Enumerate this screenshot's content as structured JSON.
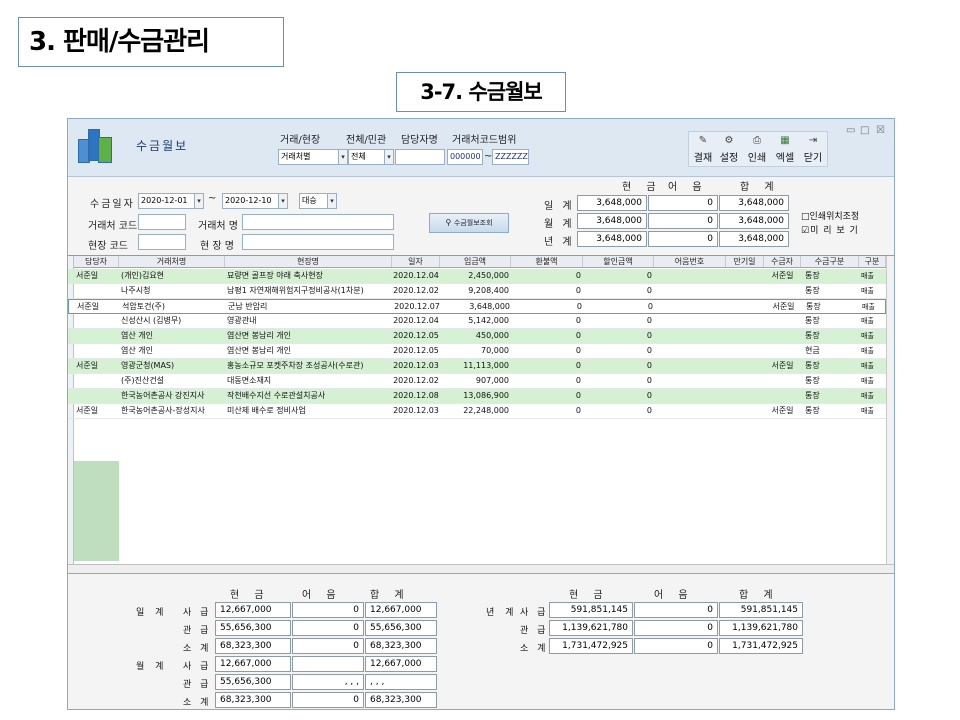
{
  "slide": {
    "title": "3. 판매/수금관리",
    "subtitle": "3-7. 수금월보"
  },
  "window": {
    "title": "수금월보",
    "controls": [
      "▭",
      "□",
      "☒"
    ],
    "toolbar": [
      {
        "label": "결재",
        "icon": "approve-icon"
      },
      {
        "label": "설정",
        "icon": "settings-icon"
      },
      {
        "label": "인쇄",
        "icon": "print-icon"
      },
      {
        "label": "엑셀",
        "icon": "excel-icon"
      },
      {
        "label": "닫기",
        "icon": "close-door-icon"
      }
    ],
    "filters_top": {
      "site_label": "거래/현장",
      "site_value": "거래처별",
      "scope_label": "전체/민관",
      "scope_value": "전체",
      "manager_label": "담당자명",
      "manager_value": "",
      "code_range_label": "거래처코드범위",
      "code_from": "000000",
      "code_sep": "~",
      "code_to": "ZZZZZZ"
    }
  },
  "filter": {
    "date_label": "수금일자",
    "date_from": "2020-12-01",
    "date_sep": "~",
    "date_to": "2020-12-10",
    "compare_value": "대승",
    "client_code_label": "거래처 코드",
    "client_name_label": "거래처 명",
    "site_code_label": "현장 코드",
    "site_name_label": "현 장 명",
    "query_button": "수금월보조회",
    "sum_headers": [
      "현 금",
      "어 음",
      "합 계"
    ],
    "sum_rows": [
      {
        "label": "일 계",
        "cash": "3,648,000",
        "note": "0",
        "total": "3,648,000"
      },
      {
        "label": "월 계",
        "cash": "3,648,000",
        "note": "0",
        "total": "3,648,000"
      },
      {
        "label": "년 계",
        "cash": "3,648,000",
        "note": "0",
        "total": "3,648,000"
      }
    ],
    "print_adjust": "□인쇄위치조정",
    "preview": "☑미 리 보 기"
  },
  "grid": {
    "columns": [
      "담당자",
      "거래처명",
      "현장명",
      "일자",
      "입금액",
      "환불액",
      "할인금액",
      "어음번호",
      "만기일",
      "수금자",
      "수금구분",
      "구분"
    ],
    "rows": [
      {
        "manager": "서준일",
        "client": "(개인)김요현",
        "site": "묘량면 골프장 야래 축사현장",
        "date": "2020.12.04",
        "amount": "2,450,000",
        "refund": "0",
        "discount": "0",
        "note_no": "",
        "due": "",
        "collector": "서준일",
        "kind": "통장",
        "type": "매출",
        "style": "green"
      },
      {
        "manager": "",
        "client": "나주시청",
        "site": "남평1 자연재해위험지구정비공사(1차분)",
        "date": "2020.12.02",
        "amount": "9,208,400",
        "refund": "0",
        "discount": "0",
        "note_no": "",
        "due": "",
        "collector": "",
        "kind": "통장",
        "type": "매출",
        "style": "white"
      },
      {
        "manager": "서준일",
        "client": "석암토건(주)",
        "site": "군남 반암리",
        "date": "2020.12.07",
        "amount": "3,648,000",
        "refund": "0",
        "discount": "0",
        "note_no": "",
        "due": "",
        "collector": "서준일",
        "kind": "통장",
        "type": "매출",
        "style": "sel"
      },
      {
        "manager": "",
        "client": "신성산시 (김병무)",
        "site": "영광관내",
        "date": "2020.12.04",
        "amount": "5,142,000",
        "refund": "0",
        "discount": "0",
        "note_no": "",
        "due": "",
        "collector": "",
        "kind": "통장",
        "type": "매출",
        "style": "white"
      },
      {
        "manager": "",
        "client": "염산 개인",
        "site": "염산면 봉남리 개인",
        "date": "2020.12.05",
        "amount": "450,000",
        "refund": "0",
        "discount": "0",
        "note_no": "",
        "due": "",
        "collector": "",
        "kind": "통장",
        "type": "매출",
        "style": "green"
      },
      {
        "manager": "",
        "client": "염산 개인",
        "site": "염산면 봉남리 개인",
        "date": "2020.12.05",
        "amount": "70,000",
        "refund": "0",
        "discount": "0",
        "note_no": "",
        "due": "",
        "collector": "",
        "kind": "현금",
        "type": "매출",
        "style": "white"
      },
      {
        "manager": "서준일",
        "client": "영광군청(MAS)",
        "site": "홍농소규모 포켓주차장 조성공사(수로관)",
        "date": "2020.12.03",
        "amount": "11,113,000",
        "refund": "0",
        "discount": "0",
        "note_no": "",
        "due": "",
        "collector": "서준일",
        "kind": "통장",
        "type": "매출",
        "style": "green"
      },
      {
        "manager": "",
        "client": "(주)진산건설",
        "site": "대동면소재지",
        "date": "2020.12.02",
        "amount": "907,000",
        "refund": "0",
        "discount": "0",
        "note_no": "",
        "due": "",
        "collector": "",
        "kind": "통장",
        "type": "매출",
        "style": "white"
      },
      {
        "manager": "",
        "client": "한국농어촌공사 강진지사",
        "site": "작천배수지선 수로관설치공사",
        "date": "2020.12.08",
        "amount": "13,086,900",
        "refund": "0",
        "discount": "0",
        "note_no": "",
        "due": "",
        "collector": "",
        "kind": "통장",
        "type": "매출",
        "style": "green"
      },
      {
        "manager": "서준일",
        "client": "한국농어촌공사-장성지사",
        "site": "미산제 배수로 정비사업",
        "date": "2020.12.03",
        "amount": "22,248,000",
        "refund": "0",
        "discount": "0",
        "note_no": "",
        "due": "",
        "collector": "서준일",
        "kind": "통장",
        "type": "매출",
        "style": "white"
      }
    ]
  },
  "bottom": {
    "headers": [
      "현 금",
      "어 음",
      "합 계"
    ],
    "daily_label": "일 계",
    "monthly_label": "월 계",
    "left_rows": [
      {
        "group": "일 계",
        "label": "사 급",
        "cash": "12,667,000",
        "note": "0",
        "total": "12,667,000"
      },
      {
        "group": "",
        "label": "관 급",
        "cash": "55,656,300",
        "note": "0",
        "total": "55,656,300"
      },
      {
        "group": "",
        "label": "소 계",
        "cash": "68,323,300",
        "note": "0",
        "total": "68,323,300"
      },
      {
        "group": "월 계",
        "label": "사 급",
        "cash": "12,667,000",
        "note": "",
        "total": "12,667,000"
      },
      {
        "group": "",
        "label": "관 급",
        "cash": "55,656,300",
        "note": ", , ,",
        "total": ", , ,"
      },
      {
        "group": "",
        "label": "소 계",
        "cash": "68,323,300",
        "note": "0",
        "total": "68,323,300"
      }
    ],
    "right_rows": [
      {
        "group": "년 계",
        "label": "사 급",
        "cash": "591,851,145",
        "note": "0",
        "total": "591,851,145"
      },
      {
        "group": "",
        "label": "관 급",
        "cash": "1,139,621,780",
        "note": "0",
        "total": "1,139,621,780"
      },
      {
        "group": "",
        "label": "소 계",
        "cash": "1,731,472,925",
        "note": "0",
        "total": "1,731,472,925"
      }
    ]
  }
}
